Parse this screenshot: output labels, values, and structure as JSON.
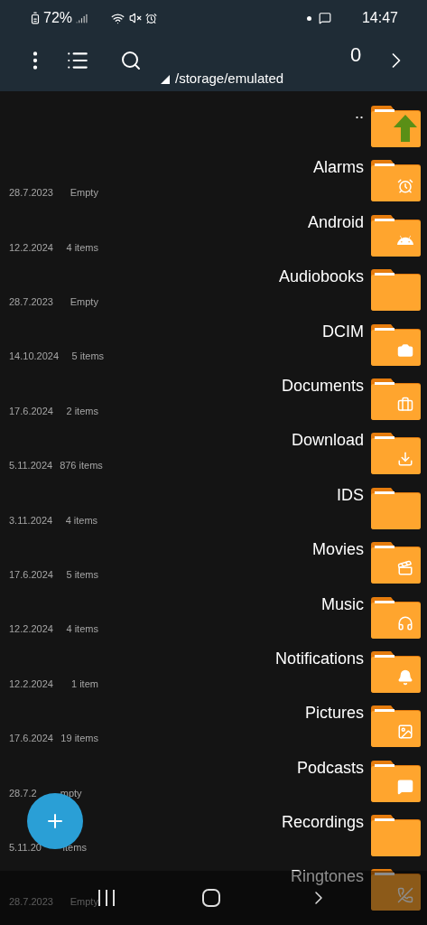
{
  "status_bar": {
    "battery": "72%",
    "time": "14:47"
  },
  "toolbar": {
    "count": "0",
    "path": "/storage/emulated"
  },
  "rows": [
    {
      "name": "..",
      "kind": "up"
    },
    {
      "name": "Alarms",
      "kind": "alarm",
      "date": "28.7.2023",
      "info": "Empty"
    },
    {
      "name": "Android",
      "kind": "android",
      "date": "12.2.2024",
      "info": "4 items"
    },
    {
      "name": "Audiobooks",
      "kind": "plain",
      "date": "28.7.2023",
      "info": "Empty"
    },
    {
      "name": "DCIM",
      "kind": "camera",
      "date": "14.10.2024",
      "info": "5 items"
    },
    {
      "name": "Documents",
      "kind": "briefcase",
      "date": "17.6.2024",
      "info": "2 items"
    },
    {
      "name": "Download",
      "kind": "download",
      "date": "5.11.2024",
      "info": "876 items"
    },
    {
      "name": "IDS",
      "kind": "plain",
      "date": "3.11.2024",
      "info": "4 items"
    },
    {
      "name": "Movies",
      "kind": "movie",
      "date": "17.6.2024",
      "info": "5 items"
    },
    {
      "name": "Music",
      "kind": "music",
      "date": "12.2.2024",
      "info": "4 items"
    },
    {
      "name": "Notifications",
      "kind": "bell",
      "date": "12.2.2024",
      "info": "1 item"
    },
    {
      "name": "Pictures",
      "kind": "image",
      "date": "17.6.2024",
      "info": "19 items"
    },
    {
      "name": "Podcasts",
      "kind": "chat",
      "date": "28.7.2",
      "info": "mpty"
    },
    {
      "name": "Recordings",
      "kind": "plain",
      "date": "5.11.20",
      "info": "items"
    },
    {
      "name": "Ringtones",
      "kind": "phone",
      "date": "28.7.2023",
      "info": "Empty"
    }
  ]
}
